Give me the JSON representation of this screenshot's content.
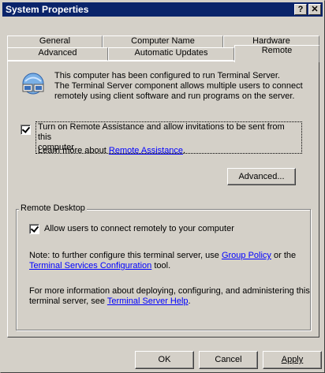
{
  "window": {
    "title": "System Properties",
    "help_glyph": "?",
    "close_glyph": "✕"
  },
  "tabs": {
    "row1": [
      {
        "label": "General"
      },
      {
        "label": "Computer Name"
      },
      {
        "label": "Hardware"
      }
    ],
    "row2": [
      {
        "label": "Advanced"
      },
      {
        "label": "Automatic Updates"
      },
      {
        "label": "Remote",
        "active": true
      }
    ]
  },
  "remote": {
    "info_text_1": "This computer has been configured to run Terminal Server.",
    "info_text_2": "The Terminal Server component allows multiple users to connect",
    "info_text_3": "remotely using client software and run programs on the server.",
    "remote_assist_label_1": "Turn on Remote Assistance and allow invitations to be sent from this",
    "remote_assist_label_2": "computer",
    "remote_assist_checked": true,
    "learn_more_prefix": "Learn more about ",
    "learn_more_link": "Remote Assistance",
    "learn_more_suffix": ".",
    "advanced_button": "Advanced..."
  },
  "remote_desktop": {
    "group_title": "Remote Desktop",
    "allow_label": "Allow users to connect remotely to your computer",
    "allow_checked": true,
    "note_prefix": "Note: to further configure this terminal server, use ",
    "note_link_1": "Group Policy",
    "note_middle": " or the",
    "note_link_2": "Terminal Services Configuration",
    "note_suffix": " tool.",
    "more_info_1": "For more information about deploying, configuring, and administering this",
    "more_info_prefix": "terminal server, see ",
    "more_info_link": "Terminal Server Help",
    "more_info_suffix": "."
  },
  "footer": {
    "ok": "OK",
    "cancel": "Cancel",
    "apply": "Apply"
  },
  "icons": {
    "computer_icon": "computer-network-icon"
  }
}
